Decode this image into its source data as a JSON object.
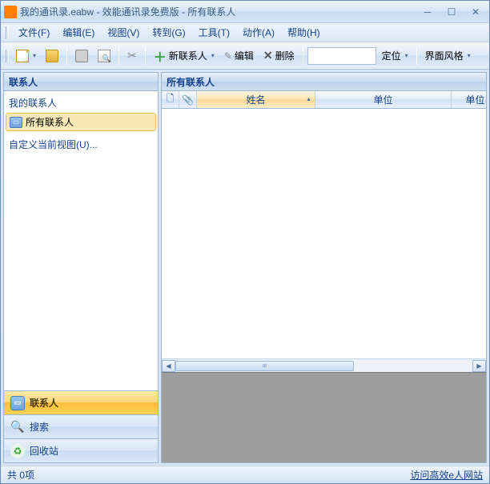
{
  "title": "我的通讯录.eabw - 效能通讯录免费版 - 所有联系人",
  "menu": {
    "file": "文件(F)",
    "edit": "编辑(E)",
    "view": "视图(V)",
    "goto": "转到(G)",
    "tools": "工具(T)",
    "action": "动作(A)",
    "help": "帮助(H)"
  },
  "toolbar": {
    "new_contact": "新联系人",
    "edit": "编辑",
    "delete": "删除",
    "locate": "定位",
    "theme": "界面风格",
    "search_value": ""
  },
  "sidebar": {
    "header": "联系人",
    "root_label": "我的联系人",
    "all_contacts": "所有联系人",
    "customize": "自定义当前视图(U)...",
    "nav_contacts": "联系人",
    "nav_search": "搜索",
    "nav_recycle": "回收站"
  },
  "grid": {
    "header": "所有联系人",
    "col_name": "姓名",
    "col_company": "单位",
    "col_unit2": "单位"
  },
  "status": {
    "count": "共 0项",
    "link": "访问高效e人网站"
  }
}
